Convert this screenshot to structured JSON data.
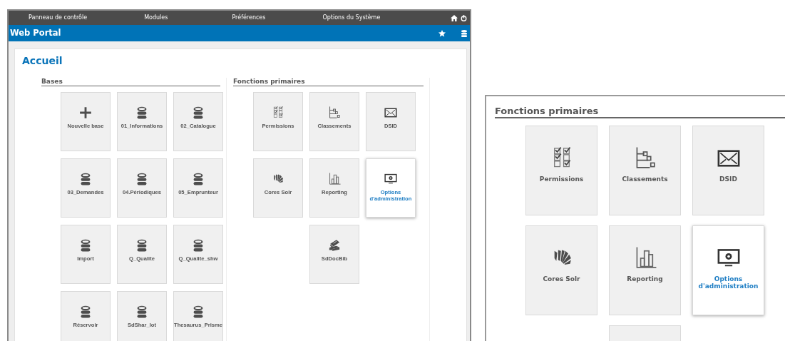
{
  "menu": [
    {
      "label": "Panneau de contrôle"
    },
    {
      "label": "Modules"
    },
    {
      "label": "Préférences"
    },
    {
      "label": "Options du Système"
    }
  ],
  "app_title": "Web Portal",
  "page_title": "Accueil",
  "sections": [
    {
      "title": "Bases",
      "tiles": [
        {
          "label": "Nouvelle base",
          "kind": "add",
          "selected": false
        },
        {
          "label": "01_Informations",
          "kind": "database",
          "selected": false
        },
        {
          "label": "02_Catalogue",
          "kind": "database",
          "selected": false
        },
        {
          "label": "03_Demandes",
          "kind": "database",
          "selected": false
        },
        {
          "label": "04.Périodiques",
          "kind": "database",
          "selected": false
        },
        {
          "label": "05_Emprunteur",
          "kind": "database",
          "selected": false
        },
        {
          "label": "Import",
          "kind": "database",
          "selected": false
        },
        {
          "label": "Q_Qualite",
          "kind": "database",
          "selected": false
        },
        {
          "label": "Q_Qualite_shw",
          "kind": "database",
          "selected": false
        },
        {
          "label": "Réservoir",
          "kind": "database",
          "selected": false
        },
        {
          "label": "SdShar_lot",
          "kind": "database",
          "selected": false
        },
        {
          "label": "Thesaurus_Prisme",
          "kind": "database",
          "selected": false
        }
      ]
    },
    {
      "title": "Fonctions primaires",
      "tiles": [
        {
          "label": "Permissions",
          "kind": "permissions",
          "selected": false
        },
        {
          "label": "Classements",
          "kind": "tree",
          "selected": false
        },
        {
          "label": "DSID",
          "kind": "mail",
          "selected": false
        },
        {
          "label": "Cores Solr",
          "kind": "shell",
          "selected": false
        },
        {
          "label": "Reporting",
          "kind": "chart",
          "selected": false
        },
        {
          "label": "Options d'administration",
          "kind": "admin",
          "selected": true
        },
        {
          "label": "SdDocBib",
          "kind": "books",
          "selected": false
        }
      ]
    }
  ],
  "inset": {
    "title": "Fonctions primaires",
    "tiles": [
      {
        "label": "Permissions",
        "kind": "permissions",
        "selected": false
      },
      {
        "label": "Classements",
        "kind": "tree",
        "selected": false
      },
      {
        "label": "DSID",
        "kind": "mail",
        "selected": false
      },
      {
        "label": "Cores Solr",
        "kind": "shell",
        "selected": false
      },
      {
        "label": "Reporting",
        "kind": "chart",
        "selected": false
      },
      {
        "label": "Options d'administration",
        "kind": "admin",
        "selected": true
      },
      {
        "kind": "cut",
        "selected": false
      }
    ]
  }
}
